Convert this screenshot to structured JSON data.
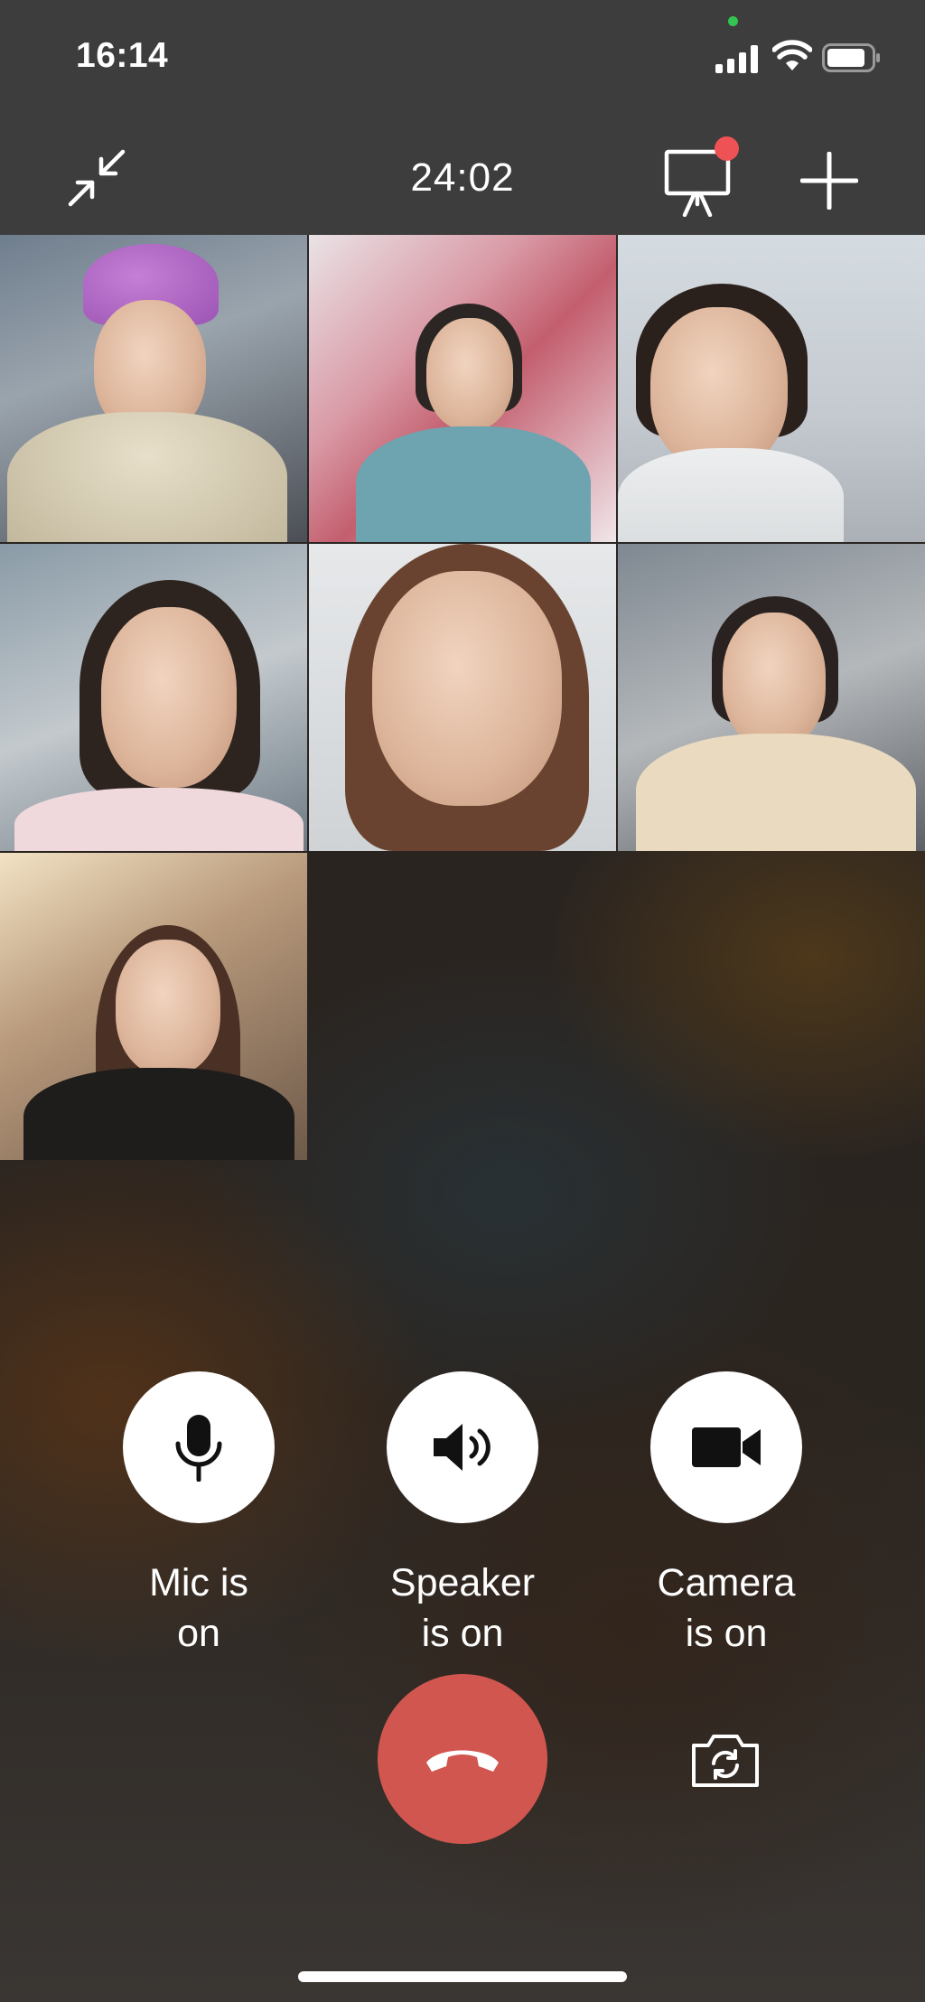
{
  "status_bar": {
    "time": "16:14",
    "icons": [
      "signal-icon",
      "wifi-icon",
      "battery-icon"
    ],
    "privacy_indicator_color": "#33c552"
  },
  "call_header": {
    "timer": "24:02",
    "icons": [
      "minimize-icon",
      "whiteboard-icon",
      "add-icon"
    ],
    "notification_badge_color": "#ef5254"
  },
  "participants_count": 7,
  "controls": {
    "mic": {
      "label": "Mic is on",
      "icon": "microphone-icon"
    },
    "speaker": {
      "label": "Speaker\nis on",
      "icon": "speaker-icon"
    },
    "camera": {
      "label": "Camera\nis on",
      "icon": "video-camera-icon"
    },
    "hangup": {
      "icon": "hang-up-icon",
      "color": "#d25650"
    },
    "flip_camera": {
      "icon": "flip-camera-icon"
    }
  },
  "colors": {
    "header_background": "#3d3d3d",
    "button_background": "#ffffff"
  }
}
